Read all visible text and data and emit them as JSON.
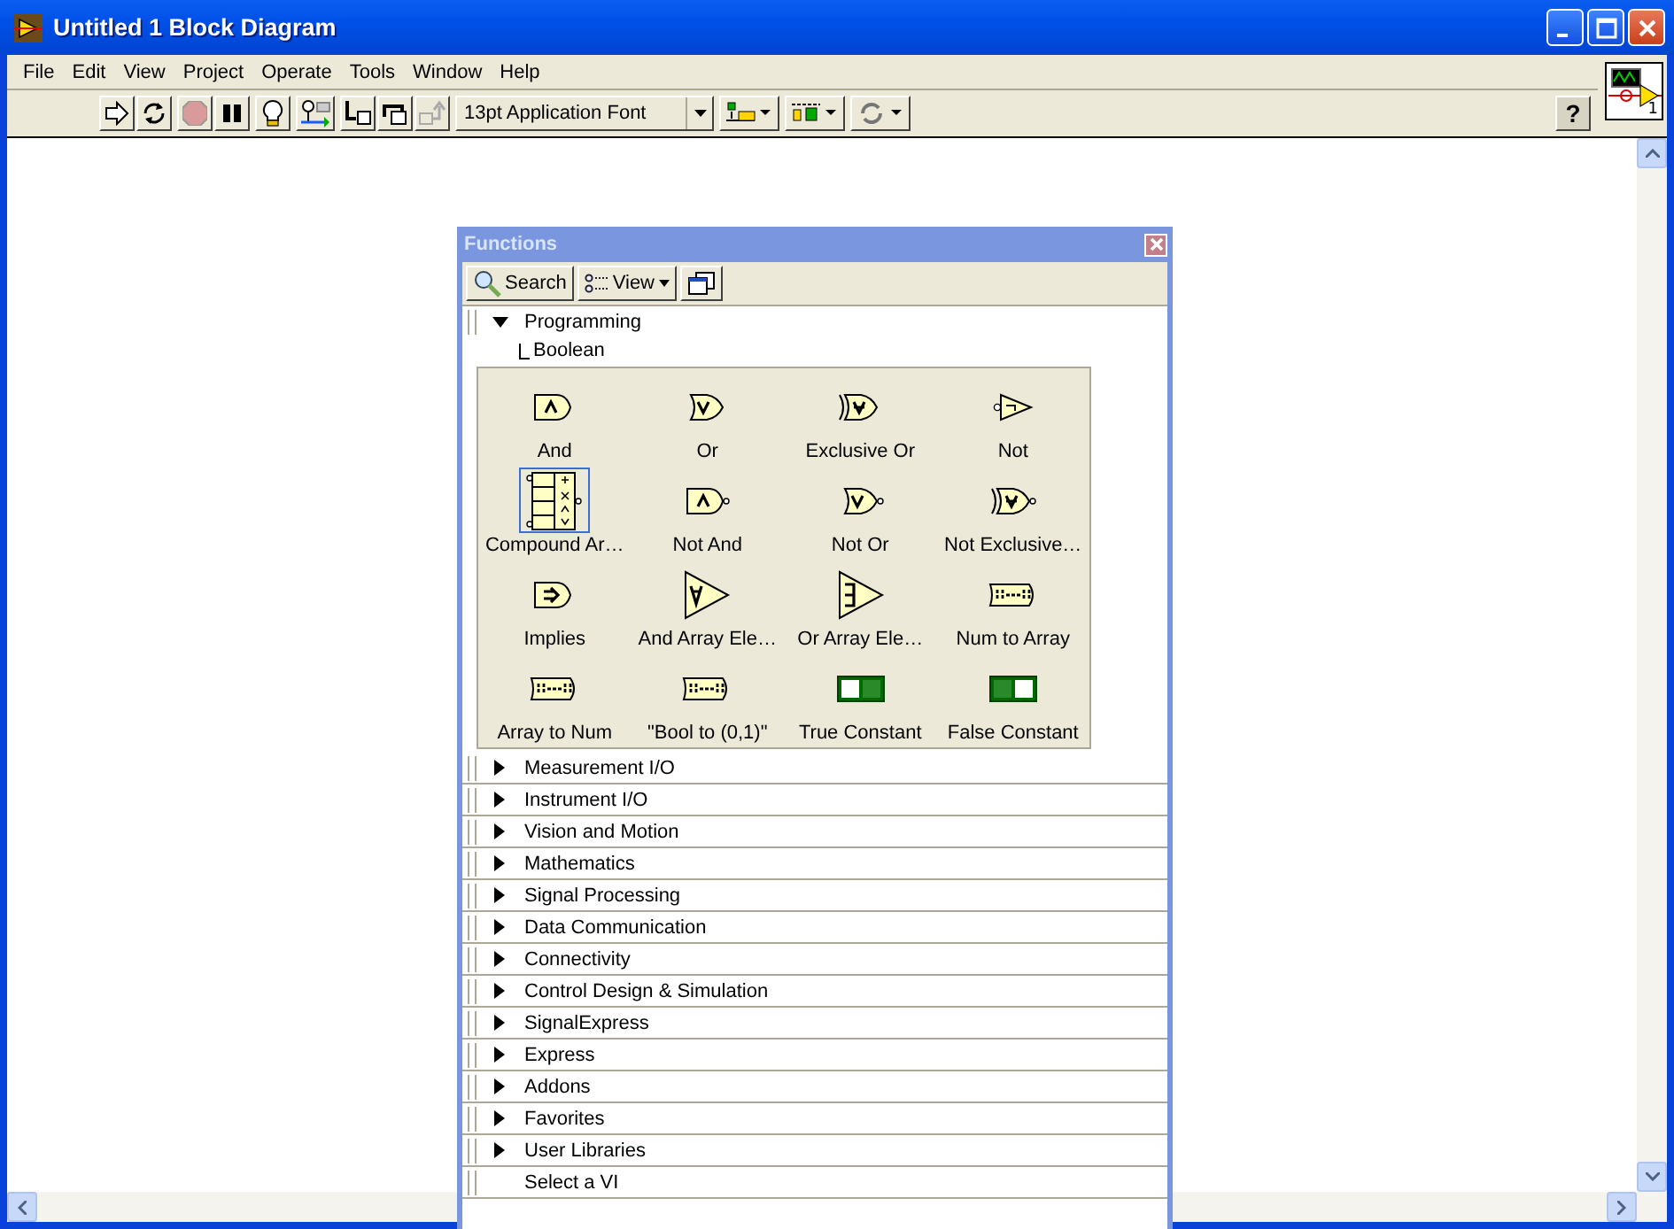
{
  "window": {
    "title": "Untitled 1 Block Diagram"
  },
  "menu": [
    "File",
    "Edit",
    "View",
    "Project",
    "Operate",
    "Tools",
    "Window",
    "Help"
  ],
  "toolbar": {
    "font": "13pt Application Font",
    "help": "?"
  },
  "connector_pane": {
    "number": "1"
  },
  "palette": {
    "title": "Functions",
    "search": "Search",
    "view": "View",
    "tree": [
      {
        "label": "Programming",
        "kind": "category",
        "expanded": true,
        "children": [
          {
            "label": "Boolean"
          }
        ]
      },
      {
        "label": "Measurement I/O",
        "kind": "category",
        "expanded": false
      },
      {
        "label": "Instrument I/O",
        "kind": "category",
        "expanded": false
      },
      {
        "label": "Vision and Motion",
        "kind": "category",
        "expanded": false
      },
      {
        "label": "Mathematics",
        "kind": "category",
        "expanded": false
      },
      {
        "label": "Signal Processing",
        "kind": "category",
        "expanded": false
      },
      {
        "label": "Data Communication",
        "kind": "category",
        "expanded": false
      },
      {
        "label": "Connectivity",
        "kind": "category",
        "expanded": false
      },
      {
        "label": "Control Design & Simulation",
        "kind": "category",
        "expanded": false
      },
      {
        "label": "SignalExpress",
        "kind": "category",
        "expanded": false
      },
      {
        "label": "Express",
        "kind": "category",
        "expanded": false
      },
      {
        "label": "Addons",
        "kind": "category",
        "expanded": false
      },
      {
        "label": "Favorites",
        "kind": "category",
        "expanded": false
      },
      {
        "label": "User Libraries",
        "kind": "category",
        "expanded": false
      },
      {
        "label": "Select a VI",
        "kind": "action"
      }
    ],
    "functions": [
      {
        "label": "And",
        "kind": "and",
        "selected": false
      },
      {
        "label": "Or",
        "kind": "or",
        "selected": false
      },
      {
        "label": "Exclusive Or",
        "kind": "xor",
        "selected": false
      },
      {
        "label": "Not",
        "kind": "not",
        "selected": false
      },
      {
        "label": "Compound Ar…",
        "kind": "compound",
        "selected": true
      },
      {
        "label": "Not And",
        "kind": "nand",
        "selected": false
      },
      {
        "label": "Not Or",
        "kind": "nor",
        "selected": false
      },
      {
        "label": "Not Exclusive…",
        "kind": "nxor",
        "selected": false
      },
      {
        "label": "Implies",
        "kind": "implies",
        "selected": false
      },
      {
        "label": "And Array Ele…",
        "kind": "and-array",
        "selected": false
      },
      {
        "label": "Or Array Ele…",
        "kind": "or-array",
        "selected": false
      },
      {
        "label": "Num to Array",
        "kind": "num-to-array",
        "selected": false
      },
      {
        "label": "Array to Num",
        "kind": "array-to-num",
        "selected": false
      },
      {
        "label": "\"Bool to (0,1)\"",
        "kind": "bool-to-num",
        "selected": false
      },
      {
        "label": "True Constant",
        "kind": "true-const",
        "selected": false
      },
      {
        "label": "False Constant",
        "kind": "false-const",
        "selected": false
      }
    ]
  }
}
